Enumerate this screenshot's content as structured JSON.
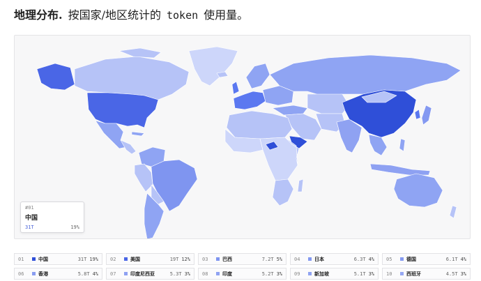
{
  "heading": {
    "bold_text": "地理分布.",
    "text_before": "按国家/地区统计的",
    "token_word": "token",
    "text_after": "使用量。"
  },
  "tooltip": {
    "rank": "#01",
    "country": "中国",
    "value": "31T",
    "share": "19%"
  },
  "colors": {
    "top": "#2f4fd8",
    "high": "#5b78f0",
    "mid": "#8fa4f3",
    "low": "#b6c3f7",
    "lowest": "#cdd6fa",
    "border": "#ffffff"
  },
  "legend": [
    {
      "rank": "01",
      "country": "中国",
      "tokens": "31T",
      "share": "19%",
      "color": "#2f4fd8"
    },
    {
      "rank": "02",
      "country": "美国",
      "tokens": "19T",
      "share": "12%",
      "color": "#4a66e6"
    },
    {
      "rank": "03",
      "country": "巴西",
      "tokens": "7.2T",
      "share": "5%",
      "color": "#7f95f0"
    },
    {
      "rank": "04",
      "country": "日本",
      "tokens": "6.3T",
      "share": "4%",
      "color": "#8499f1"
    },
    {
      "rank": "05",
      "country": "德国",
      "tokens": "6.1T",
      "share": "4%",
      "color": "#869bf1"
    },
    {
      "rank": "06",
      "country": "香港",
      "tokens": "5.8T",
      "share": "4%",
      "color": "#899df1"
    },
    {
      "rank": "07",
      "country": "印度尼西亚",
      "tokens": "5.3T",
      "share": "3%",
      "color": "#8ea1f2"
    },
    {
      "rank": "08",
      "country": "印度",
      "tokens": "5.2T",
      "share": "3%",
      "color": "#8fa2f2"
    },
    {
      "rank": "09",
      "country": "新加坡",
      "tokens": "5.1T",
      "share": "3%",
      "color": "#90a3f2"
    },
    {
      "rank": "10",
      "country": "西班牙",
      "tokens": "4.5T",
      "share": "3%",
      "color": "#96a8f3"
    }
  ]
}
